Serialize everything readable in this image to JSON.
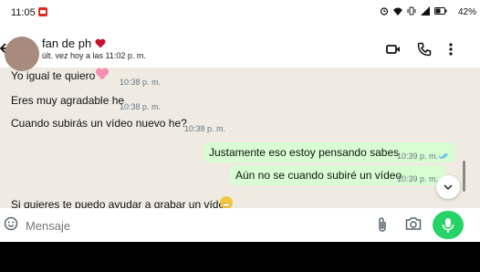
{
  "status": {
    "time": "11:05",
    "battery": "42%",
    "icons": [
      "alarm-icon",
      "wifi-icon",
      "vibrate-icon",
      "signal-icon",
      "battery-icon"
    ]
  },
  "header": {
    "name": "fan de  ph",
    "status": "últ. vez hoy a las 11:02 p. m.",
    "icons": [
      "back-arrow-icon",
      "heart-icon",
      "video-call-icon",
      "phone-icon",
      "more-vert-icon"
    ]
  },
  "messages": [
    {
      "direction": "in",
      "text": "Yo igual te quiero",
      "time": "10:38 p. m."
    },
    {
      "direction": "in",
      "text": "Eres muy agradable he",
      "time": "10:38 p. m."
    },
    {
      "direction": "in",
      "text": "Cuando subirás un vídeo nuevo he?",
      "time": "10:38 p. m."
    },
    {
      "direction": "out",
      "text": "Justamente eso estoy pensando sabes",
      "time": "10:39 p. m.",
      "read": true
    },
    {
      "direction": "out",
      "text": "Aún no se cuando subiré un vídeo",
      "time": "10:39 p. m."
    },
    {
      "direction": "in",
      "text": "Si quieres te puedo ayudar a grabar un vídeo"
    }
  ],
  "composer": {
    "placeholder": "Mensaje",
    "icons": [
      "emoji-icon",
      "attach-icon",
      "camera-icon",
      "mic-icon"
    ]
  },
  "colors": {
    "outgoing_bubble": "#d9fdd3",
    "chat_background": "#efeae2",
    "accent": "#25d366",
    "read_ticks": "#53bdeb"
  }
}
